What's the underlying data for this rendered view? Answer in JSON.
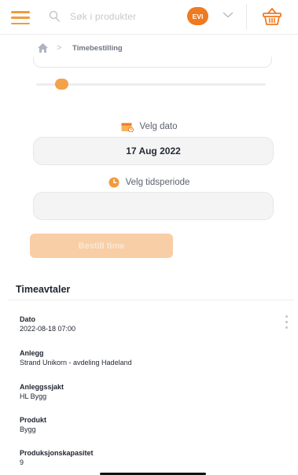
{
  "header": {
    "search_placeholder": "Søk i produkter",
    "user_initials": "EVI"
  },
  "breadcrumb": {
    "separator": ">",
    "current": "Timebestilling"
  },
  "booking": {
    "date_label": "Velg dato",
    "date_value": "17 Aug 2022",
    "period_label": "Velg tidsperiode",
    "period_value": "",
    "book_button": "Bestill time"
  },
  "appointments": {
    "title": "Timeavtaler",
    "fields": [
      {
        "label": "Dato",
        "value": "2022-08-18 07:00"
      },
      {
        "label": "Anlegg",
        "value": "Strand Unikorn - avdeling Hadeland"
      },
      {
        "label": "Anleggssjakt",
        "value": "HL Bygg"
      },
      {
        "label": "Produkt",
        "value": "Bygg"
      },
      {
        "label": "Produksjonskapasitet",
        "value": "9"
      }
    ]
  },
  "colors": {
    "accent": "#ee7a22",
    "accent_light": "#f8cea6",
    "field_bg": "#f4f4f5"
  },
  "icons": [
    "menu-icon",
    "search-icon",
    "chevron-down-icon",
    "basket-icon",
    "home-icon",
    "calendar-icon",
    "clock-icon",
    "more-vertical-icon"
  ]
}
